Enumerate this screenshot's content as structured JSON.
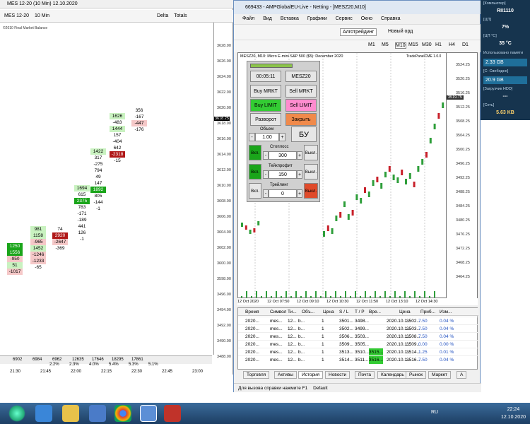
{
  "nt": {
    "title": "MES 12-20 (10 Min) 12.10.2020",
    "toolbar": [
      "MES 12-20",
      "10 Min",
      "Delta",
      "Totals"
    ],
    "copyright": "©2010 Final Market Balance",
    "y_axis": [
      "3628.00",
      "3626.00",
      "3624.00",
      "3622.00",
      "3620.00",
      "3618.00",
      "3616.00",
      "3614.00",
      "3612.00",
      "3610.00",
      "3608.00",
      "3606.00",
      "3604.00",
      "3602.00",
      "3600.00",
      "3598.00",
      "3496.00",
      "3494.00",
      "3492.00",
      "3490.00",
      "3488.00"
    ],
    "price_marker": "3618.25",
    "volumes": [
      "6902",
      "6984",
      "6962",
      "12635",
      "17646",
      "18295",
      "17861"
    ],
    "pcts": [
      "2.2%",
      "2.3%",
      "4.0%",
      "5.4%",
      "5.3%",
      "5.1%"
    ],
    "times": [
      "21:30",
      "21:45",
      "22:00",
      "22:15",
      "22:30",
      "22:45",
      "23:00"
    ],
    "columns": [
      {
        "cells": [
          [
            "1250",
            "gd"
          ],
          [
            "1556",
            "gd"
          ],
          [
            "-950",
            "r"
          ],
          [
            "51",
            "g"
          ],
          [
            "-1017",
            "r"
          ]
        ]
      },
      {
        "cells": [
          [
            "981",
            "g"
          ],
          [
            "1158",
            "g"
          ],
          [
            "-965",
            "r"
          ],
          [
            "1452",
            "g"
          ],
          [
            "-1246",
            "r"
          ],
          [
            "-1233",
            "r"
          ],
          [
            "-65",
            ""
          ]
        ]
      },
      {
        "cells": [
          [
            "74",
            ""
          ],
          [
            "2920",
            "rd"
          ],
          [
            "-2647",
            "r"
          ],
          [
            "-369",
            ""
          ]
        ]
      },
      {
        "cells": [
          [
            "1694",
            "g"
          ],
          [
            "615",
            ""
          ],
          [
            "2375",
            "gd"
          ],
          [
            "783",
            ""
          ],
          [
            "-171",
            ""
          ],
          [
            "-189",
            ""
          ],
          [
            "441",
            ""
          ],
          [
            "126",
            ""
          ],
          [
            "-1",
            ""
          ]
        ]
      },
      {
        "cells": [
          [
            "1422",
            "g"
          ],
          [
            "317",
            ""
          ],
          [
            "-275",
            ""
          ],
          [
            "794",
            ""
          ],
          [
            "49",
            ""
          ],
          [
            "147",
            ""
          ],
          [
            "1892",
            "gd"
          ],
          [
            "805",
            ""
          ],
          [
            "-144",
            ""
          ],
          [
            "-1",
            ""
          ]
        ]
      },
      {
        "cells": [
          [
            "1626",
            "g"
          ],
          [
            "-483",
            ""
          ],
          [
            "1444",
            "g"
          ],
          [
            "157",
            ""
          ],
          [
            "-404",
            ""
          ],
          [
            "642",
            ""
          ],
          [
            "-2318",
            "rd"
          ],
          [
            "-15",
            ""
          ]
        ]
      },
      {
        "cells": [
          [
            "356",
            ""
          ],
          [
            "-167",
            ""
          ],
          [
            "-447",
            "r"
          ],
          [
            "-176",
            ""
          ]
        ]
      }
    ]
  },
  "mt": {
    "title": "669433 - AMPGlobalEU-Live - Netting - [MESZ20,M10]",
    "menu": [
      "Файл",
      "Вид",
      "Вставка",
      "Графики",
      "Сервис",
      "Окно",
      "Справка"
    ],
    "toolbar": {
      "algo": "Алготрейдинг",
      "new_order": "Новый орд"
    },
    "timeframes": [
      "M1",
      "M5",
      "M10",
      "M15",
      "M30",
      "H1",
      "H4",
      "D1"
    ],
    "chart_title": "MESZ20, M10: Micro E-mini S&P 500 ($5): December 2020",
    "chart_badge": "TradePanelCME 1.0.0",
    "y_axis": [
      "3524.25",
      "3520.25",
      "3516.25",
      "3512.25",
      "3508.25",
      "3504.25",
      "3500.25",
      "3496.25",
      "3492.25",
      "3488.25",
      "3484.25",
      "3480.25",
      "3476.25",
      "3472.25",
      "3468.25",
      "3464.25"
    ],
    "price_marker": "3519.75",
    "x_axis": [
      "12 Oct 2020",
      "12 Oct 07:50",
      "12 Oct 09:10",
      "12 Oct 10:30",
      "12 Oct 11:50",
      "12 Oct 13:10",
      "12 Oct 14:30"
    ],
    "panel": {
      "time": "00:05:11",
      "symbol": "MESZ20",
      "buy_mkt": "Buy MRKT",
      "sell_mkt": "Sell MRKT",
      "buy_limit": "Buy LIMIT",
      "sell_limit": "Sell LIMIT",
      "reversal": "Разворот",
      "close": "Закрыть",
      "volume_label": "Объем",
      "volume": "1.00",
      "be": "БУ",
      "on": "Вкл.",
      "off": "Выкл.",
      "sl_label": "Стоплосс",
      "sl": "300",
      "tp_label": "Тейкпрофит",
      "tp": "150",
      "trail_label": "Трейлинг",
      "trail": "0",
      "minus": "-",
      "plus": "+"
    },
    "table_headers": [
      "Время",
      "Символ",
      "Ти...",
      "Объ...",
      "Цена",
      "S / L",
      "T / P",
      "Вре...",
      "Цена",
      "Приб...",
      "Изм..."
    ],
    "rows": [
      [
        "2020...",
        "mes...",
        "12...",
        "b...",
        "1",
        "3501...",
        "3498...",
        "",
        "2020.10.1...",
        "3502...",
        "7.50",
        "0.04 %"
      ],
      [
        "2020...",
        "mes...",
        "12...",
        "b...",
        "1",
        "3502...",
        "3499...",
        "",
        "2020.10.1...",
        "3503...",
        "7.50",
        "0.04 %"
      ],
      [
        "2020...",
        "mes...",
        "12...",
        "b...",
        "1",
        "3506...",
        "3503...",
        "",
        "2020.10.1...",
        "3508...",
        "7.50",
        "0.04 %"
      ],
      [
        "2020...",
        "mes...",
        "12...",
        "b...",
        "1",
        "3509...",
        "3505...",
        "",
        "2020.10.1...",
        "3509...",
        "0.00",
        "0.00 %"
      ],
      [
        "2020...",
        "mes...",
        "12...",
        "b...",
        "1",
        "3513...",
        "3510...",
        "3515...",
        "2020.10.1...",
        "3514...",
        "1.25",
        "0.01 %"
      ],
      [
        "2020...",
        "mes...",
        "12...",
        "b...",
        "1",
        "3514...",
        "3511...",
        "3516...",
        "2020.10.1...",
        "3516...",
        "7.50",
        "0.04 %"
      ]
    ],
    "tabs": [
      "Торговля",
      "Активы",
      "История",
      "Новости",
      "Почта",
      "Календарь",
      "Рынок",
      "Маркет",
      "А"
    ],
    "status": "Для вызова справки нажмите F1",
    "status2": "Default"
  },
  "side": {
    "computer_label": "[Компьютер]",
    "computer": "RII1110",
    "cpu_label": "[ЦП]",
    "cpu": "7%",
    "temp_label": "[ЦП °C]",
    "temp": "35 °C",
    "mem_label": "Использовано памяти",
    "mem": "2.33 GB",
    "free_label": "[C: Свободно]",
    "free": "20.9 GB",
    "hdd_label": "[Загрузчик HDD]",
    "hdd": "---",
    "net_label": "[Сеть]",
    "net": "5.63 KB"
  },
  "taskbar": {
    "lang": "RU",
    "time": "22:24",
    "date": "12.10.2020"
  }
}
